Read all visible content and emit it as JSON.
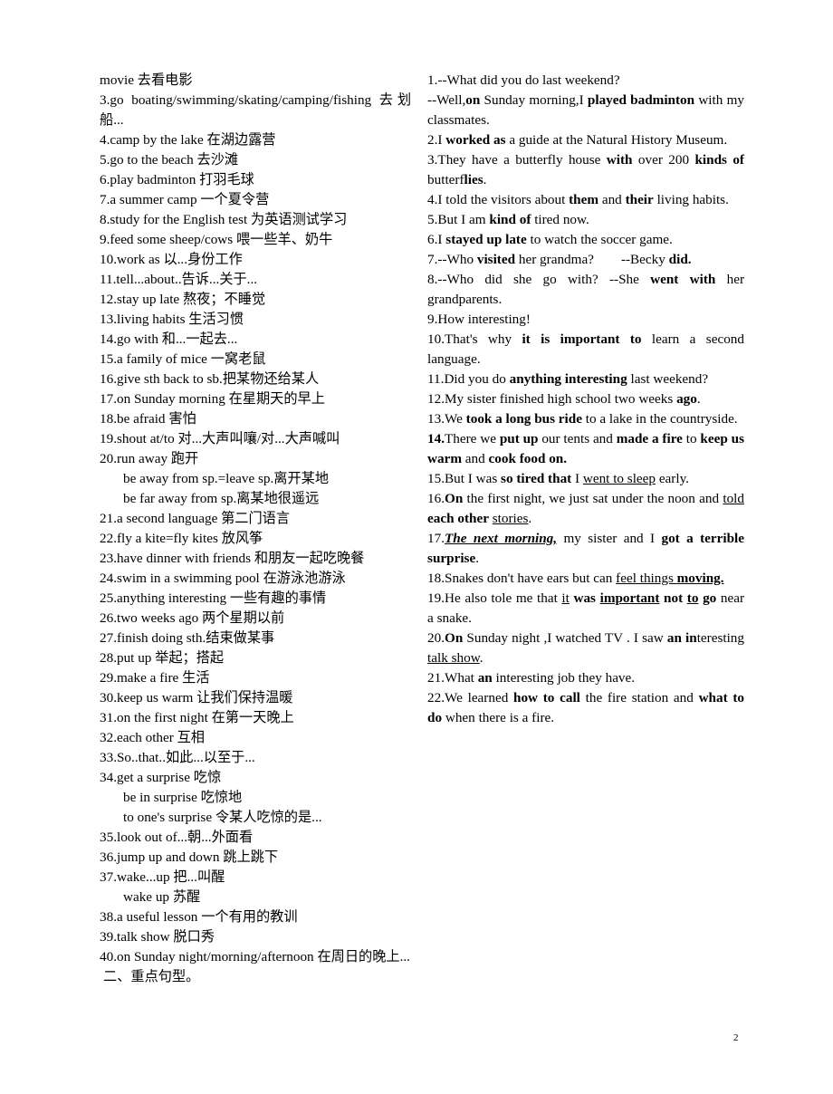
{
  "document": {
    "page_number": "2",
    "left_column": {
      "section_heading": "二、重点句型。",
      "entries": [
        {
          "id": "l-cont-movie",
          "indent": false,
          "text": "movie 去看电影"
        },
        {
          "id": "l-3",
          "indent": false,
          "text": "3.go boating/swimming/skating/camping/fishing 去划船..."
        },
        {
          "id": "l-4",
          "indent": false,
          "text": "4.camp by the lake 在湖边露营"
        },
        {
          "id": "l-5",
          "indent": false,
          "text": "5.go to the beach 去沙滩"
        },
        {
          "id": "l-6",
          "indent": false,
          "text": "6.play badminton 打羽毛球"
        },
        {
          "id": "l-7",
          "indent": false,
          "text": "7.a summer camp 一个夏令营"
        },
        {
          "id": "l-8",
          "indent": false,
          "text": "8.study for the English test 为英语测试学习"
        },
        {
          "id": "l-9",
          "indent": false,
          "text": "9.feed some sheep/cows 喂一些羊、奶牛"
        },
        {
          "id": "l-10",
          "indent": false,
          "text": "10.work as 以...身份工作"
        },
        {
          "id": "l-11",
          "indent": false,
          "text": "11.tell...about..告诉...关于..."
        },
        {
          "id": "l-12",
          "indent": false,
          "text": "12.stay up late 熬夜；不睡觉"
        },
        {
          "id": "l-13",
          "indent": false,
          "text": "13.living habits 生活习惯"
        },
        {
          "id": "l-14",
          "indent": false,
          "text": "14.go with 和...一起去..."
        },
        {
          "id": "l-15",
          "indent": false,
          "text": "15.a family of mice 一窝老鼠"
        },
        {
          "id": "l-16",
          "indent": false,
          "text": "16.give sth back to sb.把某物还给某人"
        },
        {
          "id": "l-17",
          "indent": false,
          "text": "17.on Sunday morning 在星期天的早上"
        },
        {
          "id": "l-18",
          "indent": false,
          "text": "18.be afraid 害怕"
        },
        {
          "id": "l-19",
          "indent": false,
          "text": "19.shout at/to 对...大声叫嚷/对...大声喊叫"
        },
        {
          "id": "l-20",
          "indent": false,
          "text": "20.run away 跑开"
        },
        {
          "id": "l-20a",
          "indent": true,
          "text": "be away from sp.=leave sp.离开某地"
        },
        {
          "id": "l-20b",
          "indent": true,
          "text": "be far away from sp.离某地很遥远"
        },
        {
          "id": "l-21",
          "indent": false,
          "text": "21.a second language 第二门语言"
        },
        {
          "id": "l-22",
          "indent": false,
          "text": "22.fly a kite=fly kites 放风筝"
        },
        {
          "id": "l-23",
          "indent": false,
          "text": "23.have dinner with friends 和朋友一起吃晚餐"
        },
        {
          "id": "l-24",
          "indent": false,
          "text": "24.swim in a swimming pool 在游泳池游泳"
        },
        {
          "id": "l-25",
          "indent": false,
          "text": "25.anything interesting 一些有趣的事情"
        },
        {
          "id": "l-26",
          "indent": false,
          "text": "26.two weeks ago 两个星期以前"
        },
        {
          "id": "l-27",
          "indent": false,
          "text": "27.finish doing sth.结束做某事"
        },
        {
          "id": "l-28",
          "indent": false,
          "text": "28.put up 举起；搭起"
        },
        {
          "id": "l-29",
          "indent": false,
          "text": "29.make a fire 生活"
        },
        {
          "id": "l-30",
          "indent": false,
          "text": "30.keep us warm 让我们保持温暖"
        },
        {
          "id": "l-31",
          "indent": false,
          "text": "31.on the first night 在第一天晚上"
        },
        {
          "id": "l-32",
          "indent": false,
          "text": "32.each other 互相"
        },
        {
          "id": "l-33",
          "indent": false,
          "text": "33.So..that..如此...以至于..."
        },
        {
          "id": "l-34",
          "indent": false,
          "text": "34.get a surprise 吃惊"
        },
        {
          "id": "l-34a",
          "indent": true,
          "text": "be in surprise 吃惊地"
        },
        {
          "id": "l-34b",
          "indent": true,
          "text": "to one's surprise 令某人吃惊的是..."
        },
        {
          "id": "l-35",
          "indent": false,
          "text": "35.look out of...朝...外面看"
        },
        {
          "id": "l-36",
          "indent": false,
          "text": "36.jump up and down 跳上跳下"
        },
        {
          "id": "l-37",
          "indent": false,
          "text": "37.wake...up 把...叫醒"
        },
        {
          "id": "l-37a",
          "indent": true,
          "text": "wake up 苏醒"
        },
        {
          "id": "l-38",
          "indent": false,
          "text": "38.a useful lesson 一个有用的教训"
        },
        {
          "id": "l-39",
          "indent": false,
          "text": "39.talk show 脱口秀"
        },
        {
          "id": "l-40",
          "indent": false,
          "text": "40.on Sunday night/morning/afternoon 在周日的晚上..."
        }
      ]
    },
    "right_column": {
      "entries": [
        {
          "id": "r-1",
          "runs": [
            {
              "t": "1.--What did you do last weekend?",
              "s": ""
            }
          ]
        },
        {
          "id": "r-1b",
          "runs": [
            {
              "t": "--Well,",
              "s": ""
            },
            {
              "t": "on",
              "s": "b"
            },
            {
              "t": " Sunday morning,I ",
              "s": ""
            },
            {
              "t": "played badminton",
              "s": "b"
            },
            {
              "t": " with my classmates.",
              "s": ""
            }
          ]
        },
        {
          "id": "r-2",
          "runs": [
            {
              "t": "2.I ",
              "s": ""
            },
            {
              "t": "worked as",
              "s": "b"
            },
            {
              "t": " a guide at the Natural History Museum.",
              "s": ""
            }
          ]
        },
        {
          "id": "r-3",
          "runs": [
            {
              "t": "3.They have a butterfly house ",
              "s": ""
            },
            {
              "t": "with",
              "s": "b"
            },
            {
              "t": " over 200 ",
              "s": ""
            },
            {
              "t": "kinds of",
              "s": "b"
            },
            {
              "t": " butterf",
              "s": ""
            },
            {
              "t": "lies",
              "s": "b"
            },
            {
              "t": ".",
              "s": ""
            }
          ]
        },
        {
          "id": "r-4",
          "runs": [
            {
              "t": "4.I told the visitors about ",
              "s": ""
            },
            {
              "t": "them",
              "s": "b"
            },
            {
              "t": " and ",
              "s": ""
            },
            {
              "t": "their",
              "s": "b"
            },
            {
              "t": " living habits.",
              "s": ""
            }
          ]
        },
        {
          "id": "r-5",
          "runs": [
            {
              "t": "5.But I am ",
              "s": ""
            },
            {
              "t": "kind of",
              "s": "b"
            },
            {
              "t": " tired now.",
              "s": ""
            }
          ]
        },
        {
          "id": "r-6",
          "runs": [
            {
              "t": "6.I ",
              "s": ""
            },
            {
              "t": "stayed up late",
              "s": "b"
            },
            {
              "t": " to watch the soccer game.",
              "s": ""
            }
          ]
        },
        {
          "id": "r-7",
          "runs": [
            {
              "t": "7.--Who ",
              "s": ""
            },
            {
              "t": "visited",
              "s": "b"
            },
            {
              "t": " her grandma?",
              "s": ""
            },
            {
              "t": "",
              "s": "tab"
            },
            {
              "t": "--Becky ",
              "s": ""
            },
            {
              "t": "did.",
              "s": "b"
            }
          ]
        },
        {
          "id": "r-8",
          "runs": [
            {
              "t": "8.--Who did she go with? --She ",
              "s": ""
            },
            {
              "t": "went with",
              "s": "b"
            },
            {
              "t": " her grandparents.",
              "s": ""
            }
          ]
        },
        {
          "id": "r-9",
          "runs": [
            {
              "t": "9.How interesting!",
              "s": ""
            }
          ]
        },
        {
          "id": "r-10",
          "runs": [
            {
              "t": "10.That's why ",
              "s": ""
            },
            {
              "t": "it is important to",
              "s": "b"
            },
            {
              "t": " learn a second language.",
              "s": ""
            }
          ]
        },
        {
          "id": "r-11",
          "runs": [
            {
              "t": "11.Did you do ",
              "s": ""
            },
            {
              "t": "anything interesting",
              "s": "b"
            },
            {
              "t": " last weekend?",
              "s": ""
            }
          ]
        },
        {
          "id": "r-12",
          "runs": [
            {
              "t": "12.My sister finished high school two weeks ",
              "s": ""
            },
            {
              "t": "ago",
              "s": "b"
            },
            {
              "t": ".",
              "s": ""
            }
          ]
        },
        {
          "id": "r-13",
          "runs": [
            {
              "t": "13.We ",
              "s": ""
            },
            {
              "t": "took a long bus ride",
              "s": "b"
            },
            {
              "t": " to a lake in the countryside.",
              "s": ""
            }
          ]
        },
        {
          "id": "r-14",
          "runs": [
            {
              "t": "14.",
              "s": "b"
            },
            {
              "t": "There we ",
              "s": ""
            },
            {
              "t": "put up",
              "s": "b"
            },
            {
              "t": " our tents and ",
              "s": ""
            },
            {
              "t": "made a fire",
              "s": "b"
            },
            {
              "t": " to ",
              "s": ""
            },
            {
              "t": "keep us warm",
              "s": "b"
            },
            {
              "t": " and ",
              "s": ""
            },
            {
              "t": "cook food on.",
              "s": "b"
            }
          ]
        },
        {
          "id": "r-15",
          "runs": [
            {
              "t": "15.But I was ",
              "s": ""
            },
            {
              "t": "so tired that",
              "s": "b"
            },
            {
              "t": " I ",
              "s": ""
            },
            {
              "t": "went to sleep",
              "s": "u"
            },
            {
              "t": " early.",
              "s": ""
            }
          ]
        },
        {
          "id": "r-16",
          "runs": [
            {
              "t": "16.",
              "s": ""
            },
            {
              "t": "On",
              "s": "b"
            },
            {
              "t": " the first night, we just sat under the noon and ",
              "s": ""
            },
            {
              "t": "told",
              "s": "u"
            },
            {
              "t": " ",
              "s": ""
            },
            {
              "t": "each other",
              "s": "b"
            },
            {
              "t": " ",
              "s": ""
            },
            {
              "t": "stories",
              "s": "u"
            },
            {
              "t": ".",
              "s": ""
            }
          ]
        },
        {
          "id": "r-17",
          "runs": [
            {
              "t": "17.",
              "s": ""
            },
            {
              "t": "The next morning,",
              "s": "biu"
            },
            {
              "t": " my sister and I ",
              "s": ""
            },
            {
              "t": "got a terrible surprise",
              "s": "b"
            },
            {
              "t": ".",
              "s": ""
            }
          ]
        },
        {
          "id": "r-18",
          "runs": [
            {
              "t": "18.Snakes don't have ears but can ",
              "s": ""
            },
            {
              "t": "feel things ",
              "s": "u"
            },
            {
              "t": "moving.",
              "s": "bu"
            }
          ]
        },
        {
          "id": "r-19",
          "runs": [
            {
              "t": "19.He also tole me that ",
              "s": ""
            },
            {
              "t": "it",
              "s": "u"
            },
            {
              "t": " ",
              "s": ""
            },
            {
              "t": "was",
              "s": "b"
            },
            {
              "t": " ",
              "s": ""
            },
            {
              "t": "important",
              "s": "bu"
            },
            {
              "t": " ",
              "s": ""
            },
            {
              "t": "not",
              "s": "b"
            },
            {
              "t": " ",
              "s": ""
            },
            {
              "t": "to",
              "s": "bu"
            },
            {
              "t": " ",
              "s": ""
            },
            {
              "t": "go",
              "s": "b"
            },
            {
              "t": " near a snake.",
              "s": ""
            }
          ]
        },
        {
          "id": "r-20",
          "runs": [
            {
              "t": "20.",
              "s": ""
            },
            {
              "t": "On",
              "s": "b"
            },
            {
              "t": " Sunday night ,I watched TV . I saw ",
              "s": ""
            },
            {
              "t": "an in",
              "s": "b"
            },
            {
              "t": "teresting ",
              "s": ""
            },
            {
              "t": "talk show",
              "s": "u"
            },
            {
              "t": ".",
              "s": ""
            }
          ]
        },
        {
          "id": "r-21",
          "runs": [
            {
              "t": "21.What ",
              "s": ""
            },
            {
              "t": "an",
              "s": "b"
            },
            {
              "t": " interesting job they have.",
              "s": ""
            }
          ]
        },
        {
          "id": "r-22",
          "runs": [
            {
              "t": "22.We learned ",
              "s": ""
            },
            {
              "t": "how to call",
              "s": "b"
            },
            {
              "t": " the fire station and ",
              "s": ""
            },
            {
              "t": "what to do",
              "s": "b"
            },
            {
              "t": " when there is a fire.",
              "s": ""
            }
          ]
        }
      ]
    }
  }
}
